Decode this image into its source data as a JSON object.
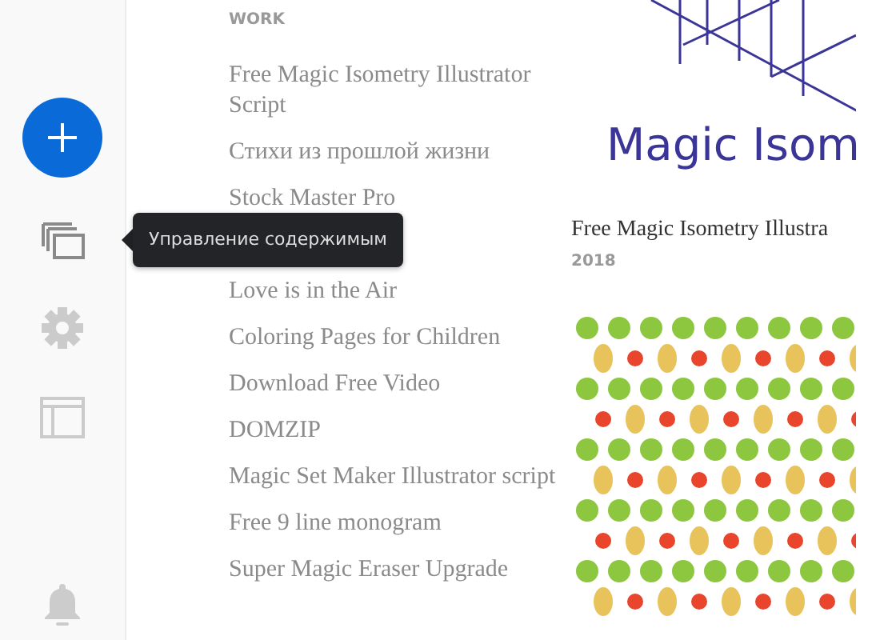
{
  "sidebar": {
    "items": [
      {
        "kind": "stack",
        "selected": true,
        "tooltip": "Управление содержимым"
      },
      {
        "kind": "gear",
        "selected": false
      },
      {
        "kind": "layout",
        "selected": false
      }
    ]
  },
  "work": {
    "heading": "WORK",
    "items": [
      {
        "label": "Free Magic Isometry Illustrator Script"
      },
      {
        "label": "Стихи из прошлой жизни"
      },
      {
        "label": "Stock Master Pro"
      },
      {
        "label": "Love is in the Air"
      },
      {
        "label": "Coloring Pages for Children"
      },
      {
        "label": "Download Free Video"
      },
      {
        "label": "DOMZIP"
      },
      {
        "label": "Magic Set Maker Illustrator script"
      },
      {
        "label": "Free 9 line monogram"
      },
      {
        "label": "Super Magic Eraser Upgrade"
      }
    ]
  },
  "feature": {
    "thumbnail_text": "Magic Isom",
    "title": "Free Magic Isometry Illustra",
    "year": "2018"
  }
}
